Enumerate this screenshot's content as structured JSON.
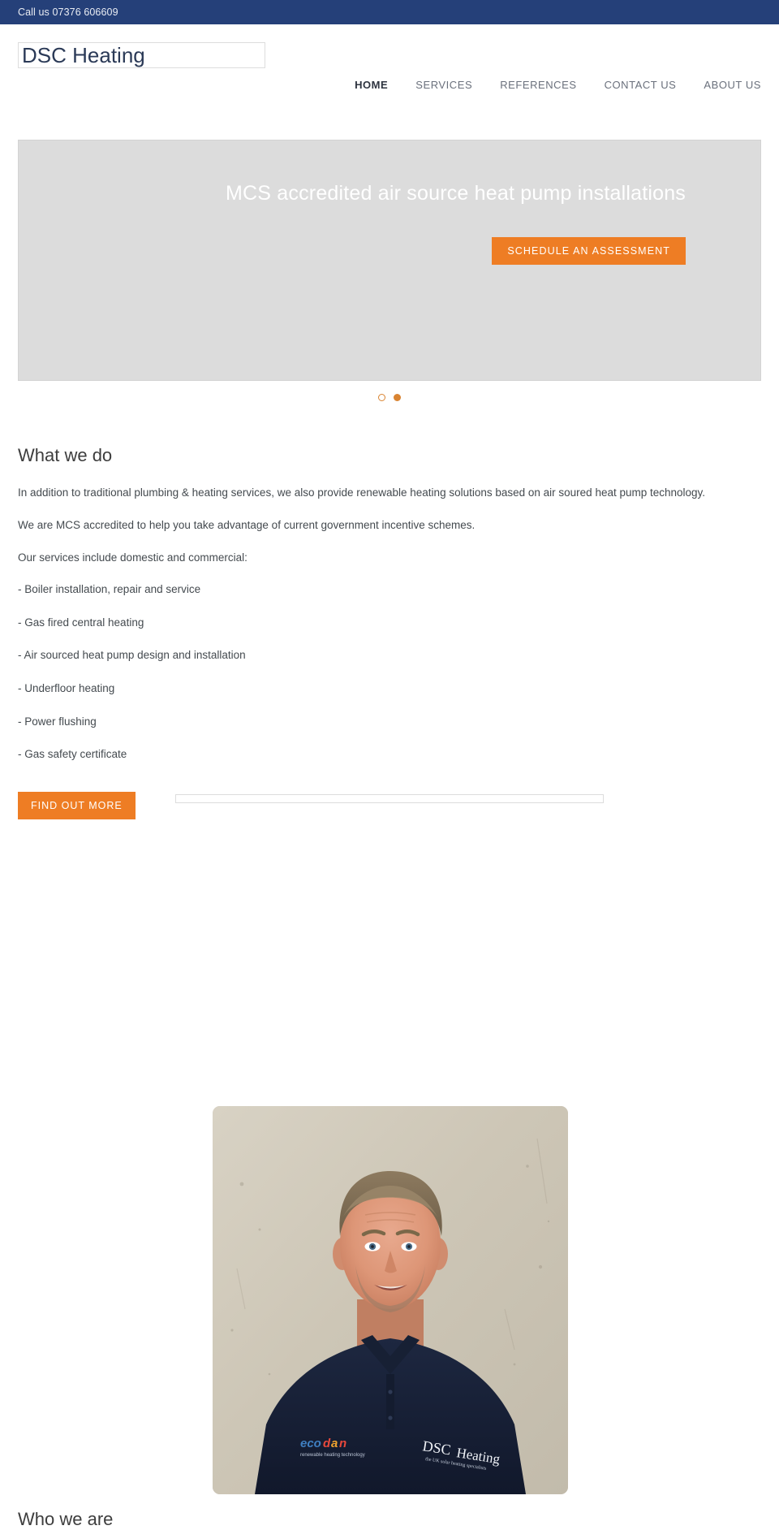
{
  "topbar": {
    "phone": "Call us 07376 606609"
  },
  "header": {
    "logo": "DSC Heating",
    "nav": [
      {
        "label": "HOME",
        "active": true
      },
      {
        "label": "SERVICES",
        "active": false
      },
      {
        "label": "REFERENCES",
        "active": false
      },
      {
        "label": "CONTACT US",
        "active": false
      },
      {
        "label": "ABOUT US",
        "active": false
      }
    ]
  },
  "hero": {
    "title": "MCS accredited air source heat pump installations",
    "cta_label": "SCHEDULE AN ASSESSMENT",
    "slides_total": 2,
    "active_slide": 2
  },
  "main": {
    "section_title": "What we do",
    "paragraphs": [
      "In addition to traditional plumbing & heating services, we also provide renewable heating solutions based on air soured heat pump technology.",
      "We are MCS accredited to help you take advantage of current government incentive schemes.",
      "Our services include domestic and commercial:"
    ],
    "services": [
      "- Boiler installation, repair and service",
      "- Gas fired central heating",
      "- Air sourced heat pump design and installation",
      "- Underfloor heating",
      "- Power flushing",
      "- Gas safety certificate"
    ],
    "find_out_more_label": "FIND OUT MORE"
  },
  "photo": {
    "alt": "Portrait of DSC Heating engineer in navy polo shirt with ecodan and DSC Heating logos"
  },
  "bottom": {
    "heading": "Who we are"
  },
  "colors": {
    "topbar": "#254079",
    "accent_orange": "#ee7d24",
    "dot_orange": "#d98432",
    "hero_bg": "#dcdcdc",
    "logo_navy": "#2b3a57"
  }
}
